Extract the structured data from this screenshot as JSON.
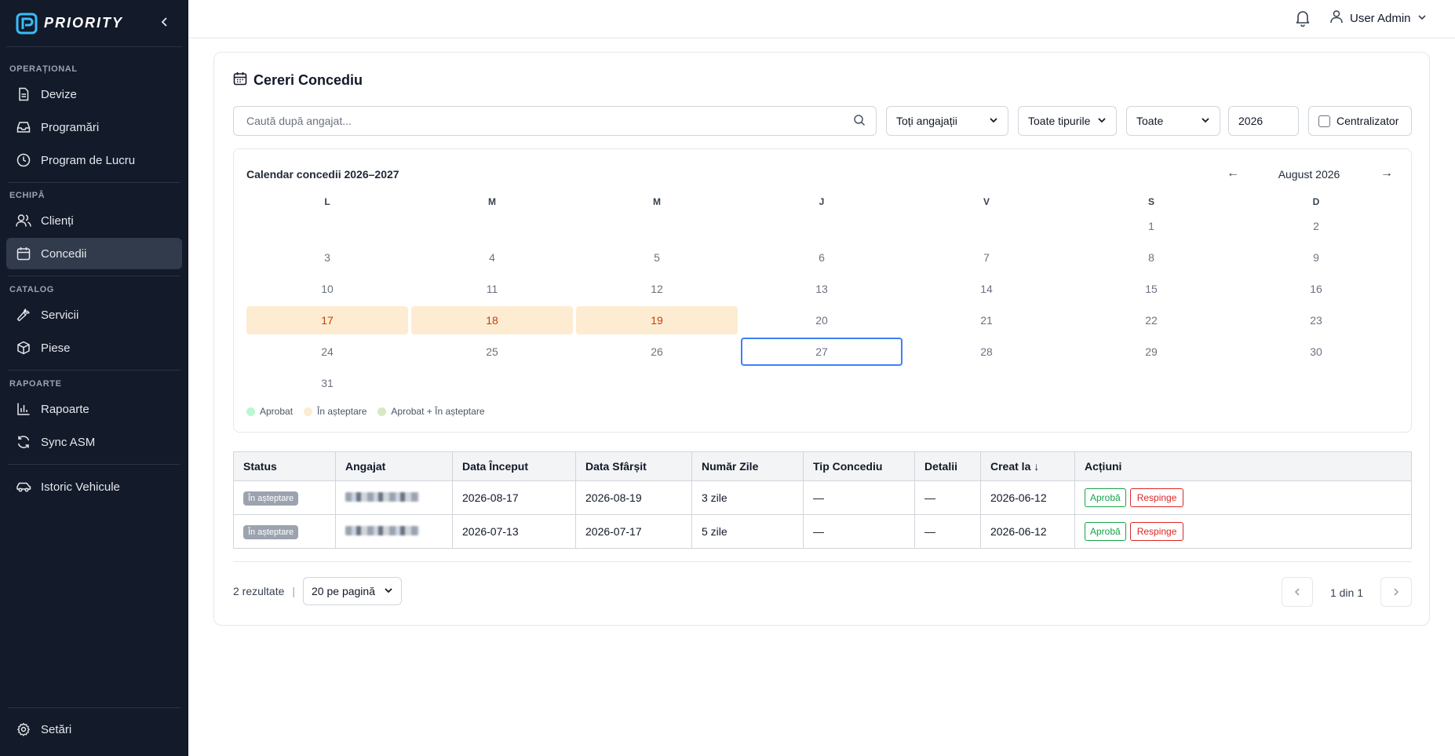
{
  "app": {
    "brand": "PRIORITY"
  },
  "sidebar": {
    "sections": [
      {
        "label": "OPERAȚIONAL"
      },
      {
        "label": "ECHIPĂ"
      },
      {
        "label": "CATALOG"
      },
      {
        "label": "RAPOARTE"
      }
    ],
    "items": [
      {
        "label": "Devize",
        "icon": "file-icon"
      },
      {
        "label": "Programări",
        "icon": "inbox-icon"
      },
      {
        "label": "Program de Lucru",
        "icon": "clock-icon"
      },
      {
        "label": "Clienți",
        "icon": "users-icon"
      },
      {
        "label": "Concedii",
        "icon": "calendar-icon",
        "active": true
      },
      {
        "label": "Servicii",
        "icon": "wrench-icon"
      },
      {
        "label": "Piese",
        "icon": "box-icon"
      },
      {
        "label": "Rapoarte",
        "icon": "bar-chart-icon"
      },
      {
        "label": "Sync ASM",
        "icon": "refresh-icon"
      },
      {
        "label": "Istoric Vehicule",
        "icon": "car-icon"
      }
    ],
    "settings": {
      "label": "Setări",
      "icon": "gear-icon"
    }
  },
  "topbar": {
    "user": "User Admin"
  },
  "page": {
    "title": "Cereri Concediu",
    "filters": {
      "search_placeholder": "Caută după angajat...",
      "employees": "Toți angajații",
      "types": "Toate tipurile",
      "status": "Toate",
      "year": "2026",
      "centralizer": "Centralizator",
      "centralizer_checked": false
    },
    "calendar": {
      "title": "Calendar concedii 2026–2027",
      "month": "August 2026",
      "prev": "←",
      "next": "→",
      "weekdays": [
        "L",
        "M",
        "M",
        "J",
        "V",
        "S",
        "D"
      ],
      "weeks": [
        [
          "",
          "",
          "",
          "",
          "",
          "1",
          "2"
        ],
        [
          "3",
          "4",
          "5",
          "6",
          "7",
          "8",
          "9"
        ],
        [
          "10",
          "11",
          "12",
          "13",
          "14",
          "15",
          "16"
        ],
        [
          "17",
          "18",
          "19",
          "20",
          "21",
          "22",
          "23"
        ],
        [
          "24",
          "25",
          "26",
          "27",
          "28",
          "29",
          "30"
        ],
        [
          "31",
          "",
          "",
          "",
          "",
          "",
          ""
        ]
      ],
      "pending_days": [
        "17",
        "18",
        "19"
      ],
      "today": "27",
      "legend": [
        {
          "label": "Aprobat",
          "color": "#bbf7d0"
        },
        {
          "label": "În așteptare",
          "color": "#fdecd2"
        },
        {
          "label": "Aprobat + În așteptare",
          "color": "#d9e8c4"
        }
      ]
    },
    "table": {
      "headers": [
        "Status",
        "Angajat",
        "Data Început",
        "Data Sfârșit",
        "Număr Zile",
        "Tip Concediu",
        "Detalii",
        "Creat la ↓",
        "Acțiuni"
      ],
      "rows": [
        {
          "status": "În așteptare",
          "start": "2026-08-17",
          "end": "2026-08-19",
          "days": "3 zile",
          "type": "—",
          "details": "—",
          "created": "2026-06-12",
          "approve": "Aprobă",
          "reject": "Respinge"
        },
        {
          "status": "În așteptare",
          "start": "2026-07-13",
          "end": "2026-07-17",
          "days": "5 zile",
          "type": "—",
          "details": "—",
          "created": "2026-06-12",
          "approve": "Aprobă",
          "reject": "Respinge"
        }
      ]
    },
    "footer": {
      "results": "2 rezultate",
      "pipe": "|",
      "per_page": "20 pe pagină",
      "page": "1 din 1"
    }
  }
}
